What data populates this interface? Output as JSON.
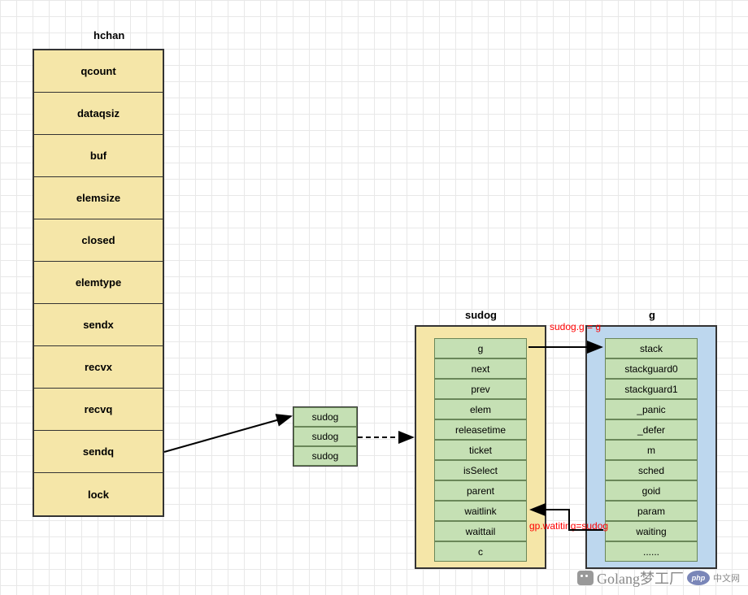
{
  "hchan": {
    "title": "hchan",
    "fields": [
      "qcount",
      "dataqsiz",
      "buf",
      "elemsize",
      "closed",
      "elemtype",
      "sendx",
      "recvx",
      "recvq",
      "sendq",
      "lock"
    ]
  },
  "sudog_list": {
    "items": [
      "sudog",
      "sudog",
      "sudog"
    ]
  },
  "sudog_struct": {
    "title": "sudog",
    "fields": [
      "g",
      "next",
      "prev",
      "elem",
      "releasetime",
      "ticket",
      "isSelect",
      "parent",
      "waitlink",
      "waittail",
      "c"
    ]
  },
  "g_struct": {
    "title": "g",
    "fields": [
      "stack",
      "stackguard0",
      "stackguard1",
      "_panic",
      "_defer",
      "m",
      "sched",
      "goid",
      "param",
      "waiting",
      "......"
    ]
  },
  "labels": {
    "sudog_g": "sudog.g = g",
    "gp_waiting": "gp.watiting=sudog"
  },
  "watermark": {
    "main": "Golang梦工厂",
    "sub": "中文网",
    "php": "php"
  }
}
